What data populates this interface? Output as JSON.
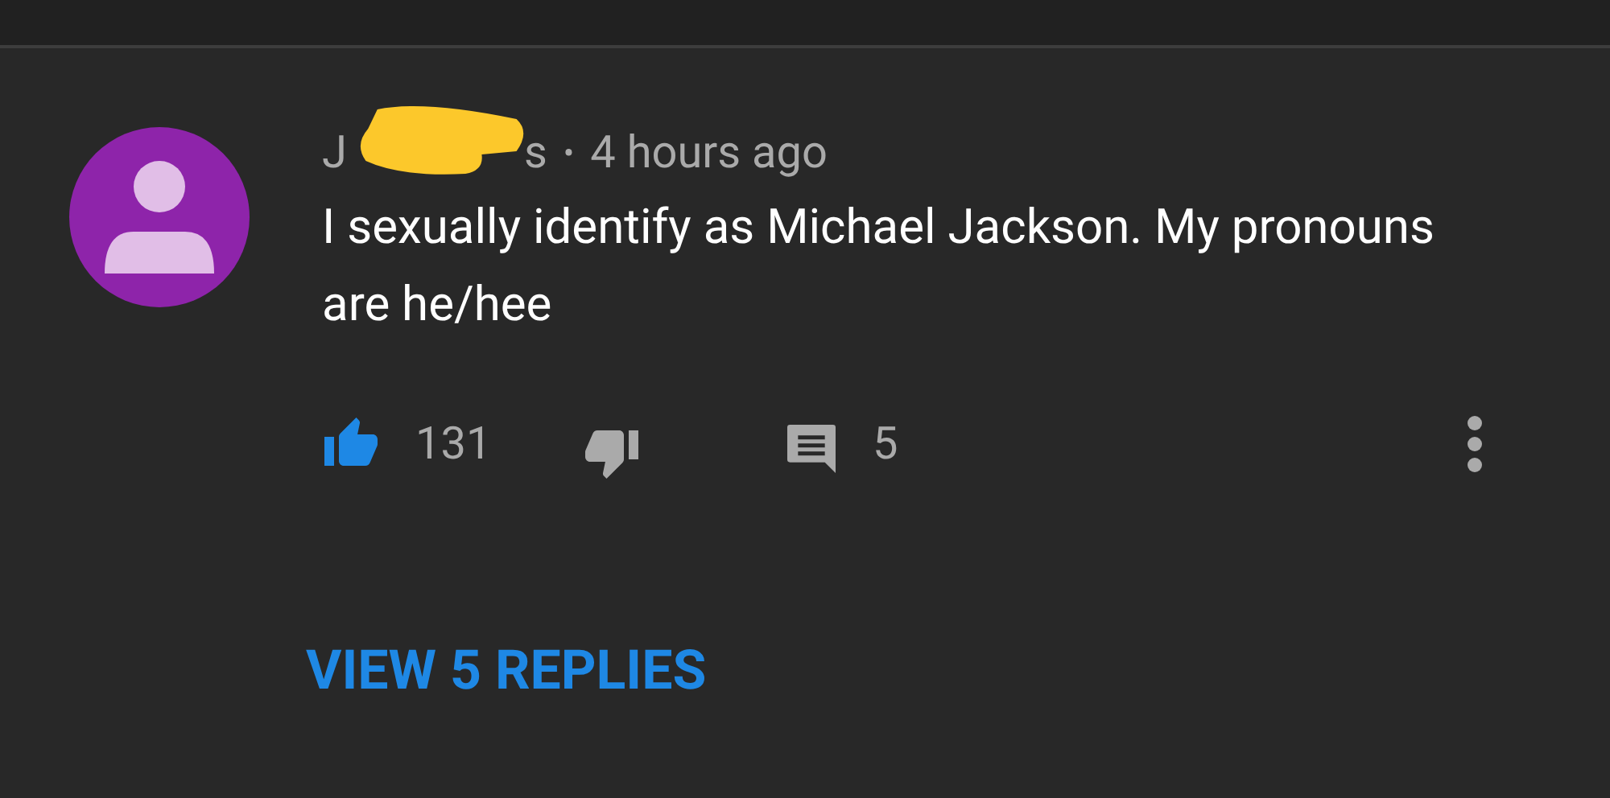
{
  "comment": {
    "author_start": "J",
    "author_end": "s",
    "separator": "•",
    "time": "4 hours ago",
    "text": "I sexually identify as Michael Jackson. My pronouns are he/hee",
    "likes": "131",
    "liked": true,
    "disliked": false,
    "replies_count": "5"
  },
  "view_replies": "VIEW 5 REPLIES"
}
